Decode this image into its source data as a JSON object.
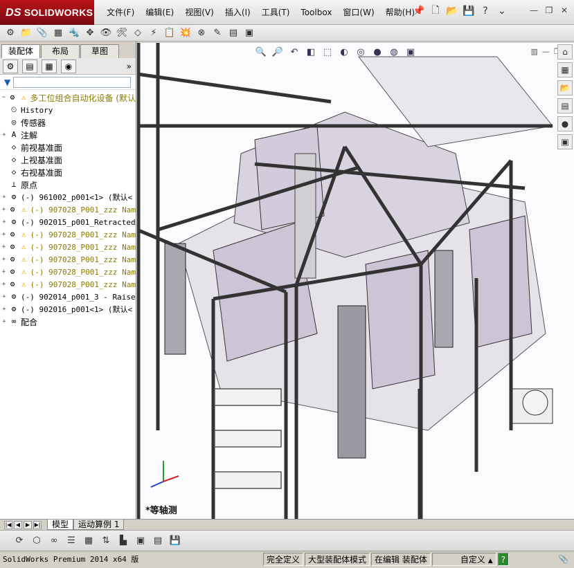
{
  "app": {
    "brand": "SOLIDWORKS",
    "brand_prefix": "DS"
  },
  "menu": [
    "文件(F)",
    "编辑(E)",
    "视图(V)",
    "插入(I)",
    "工具(T)",
    "Toolbox",
    "窗口(W)",
    "帮助(H)"
  ],
  "tabs": [
    "装配体",
    "布局",
    "草图"
  ],
  "tree": {
    "root": "多工位组合自动化设备 (默认",
    "items": [
      {
        "label": "History",
        "icon": "history-icon",
        "exp": ""
      },
      {
        "label": "传感器",
        "icon": "sensor-icon",
        "exp": ""
      },
      {
        "label": "注解",
        "icon": "annotation-icon",
        "exp": "+"
      },
      {
        "label": "前视基准面",
        "icon": "plane-icon",
        "exp": ""
      },
      {
        "label": "上视基准面",
        "icon": "plane-icon",
        "exp": ""
      },
      {
        "label": "右视基准面",
        "icon": "plane-icon",
        "exp": ""
      },
      {
        "label": "原点",
        "icon": "origin-icon",
        "exp": ""
      },
      {
        "label": "(-) 961002_p001<1> (默认<",
        "icon": "part-icon",
        "exp": "+",
        "warn": false
      },
      {
        "label": "(-) 907028_P001_zzz Nam",
        "icon": "part-icon",
        "exp": "+",
        "warn": true
      },
      {
        "label": "(-) 902015_p001_Retracted",
        "icon": "part-icon",
        "exp": "+",
        "warn": false
      },
      {
        "label": "(-) 907028_P001_zzz Nam",
        "icon": "part-icon",
        "exp": "+",
        "warn": true
      },
      {
        "label": "(-) 907028_P001_zzz Nam",
        "icon": "part-icon",
        "exp": "+",
        "warn": true
      },
      {
        "label": "(-) 907028_P001_zzz Nam",
        "icon": "part-icon",
        "exp": "+",
        "warn": true
      },
      {
        "label": "(-) 907028_P001_zzz Nam",
        "icon": "part-icon",
        "exp": "+",
        "warn": true
      },
      {
        "label": "(-) 907028_P001_zzz Nam",
        "icon": "part-icon",
        "exp": "+",
        "warn": true
      },
      {
        "label": "(-) 902014_p001_3 - Raise",
        "icon": "part-icon",
        "exp": "+",
        "warn": false
      },
      {
        "label": "(-) 902016_p001<1> (默认<",
        "icon": "part-icon",
        "exp": "+",
        "warn": false
      },
      {
        "label": "配合",
        "icon": "mates-icon",
        "exp": "+"
      }
    ]
  },
  "viewport": {
    "view_label": "*等轴测"
  },
  "bottom_tabs": [
    "模型",
    "运动算例 1"
  ],
  "status": {
    "product": "SolidWorks Premium 2014 x64 版",
    "defined": "完全定义",
    "mode": "大型装配体模式",
    "editing": "在编辑 装配体",
    "custom": "自定义",
    "arrow": "▲"
  }
}
